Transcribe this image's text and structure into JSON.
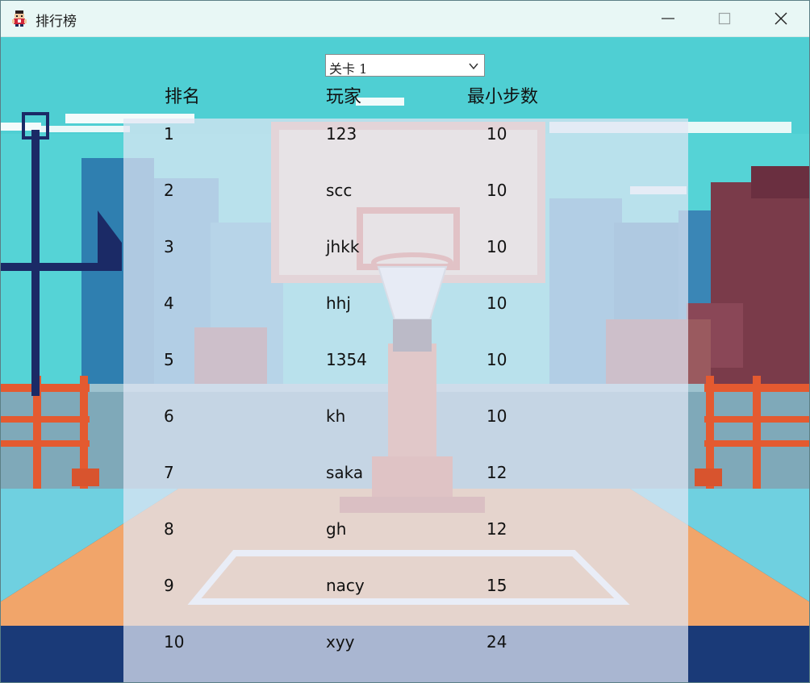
{
  "window": {
    "title": "排行榜"
  },
  "level_select": {
    "value": "关卡 1"
  },
  "table": {
    "headers": {
      "rank": "排名",
      "player": "玩家",
      "steps": "最小步数"
    },
    "rows": [
      {
        "rank": "1",
        "player": "123",
        "steps": "10"
      },
      {
        "rank": "2",
        "player": "scc",
        "steps": "10"
      },
      {
        "rank": "3",
        "player": "jhkk",
        "steps": "10"
      },
      {
        "rank": "4",
        "player": "hhj",
        "steps": "10"
      },
      {
        "rank": "5",
        "player": "1354",
        "steps": "10"
      },
      {
        "rank": "6",
        "player": "kh",
        "steps": "10"
      },
      {
        "rank": "7",
        "player": "saka",
        "steps": "12"
      },
      {
        "rank": "8",
        "player": "gh",
        "steps": "12"
      },
      {
        "rank": "9",
        "player": "nacy",
        "steps": "15"
      },
      {
        "rank": "10",
        "player": "xyy",
        "steps": "24"
      }
    ]
  },
  "icons": {
    "app": "pixel-character-icon",
    "minimize": "minimize-icon",
    "maximize": "maximize-icon",
    "close": "close-icon",
    "dropdown": "chevron-down-icon"
  },
  "colors": {
    "sky": "#55d3d6",
    "court": "#f1a56a",
    "panel": "#e1e6f4",
    "titlebar": "#e8f7f5"
  }
}
